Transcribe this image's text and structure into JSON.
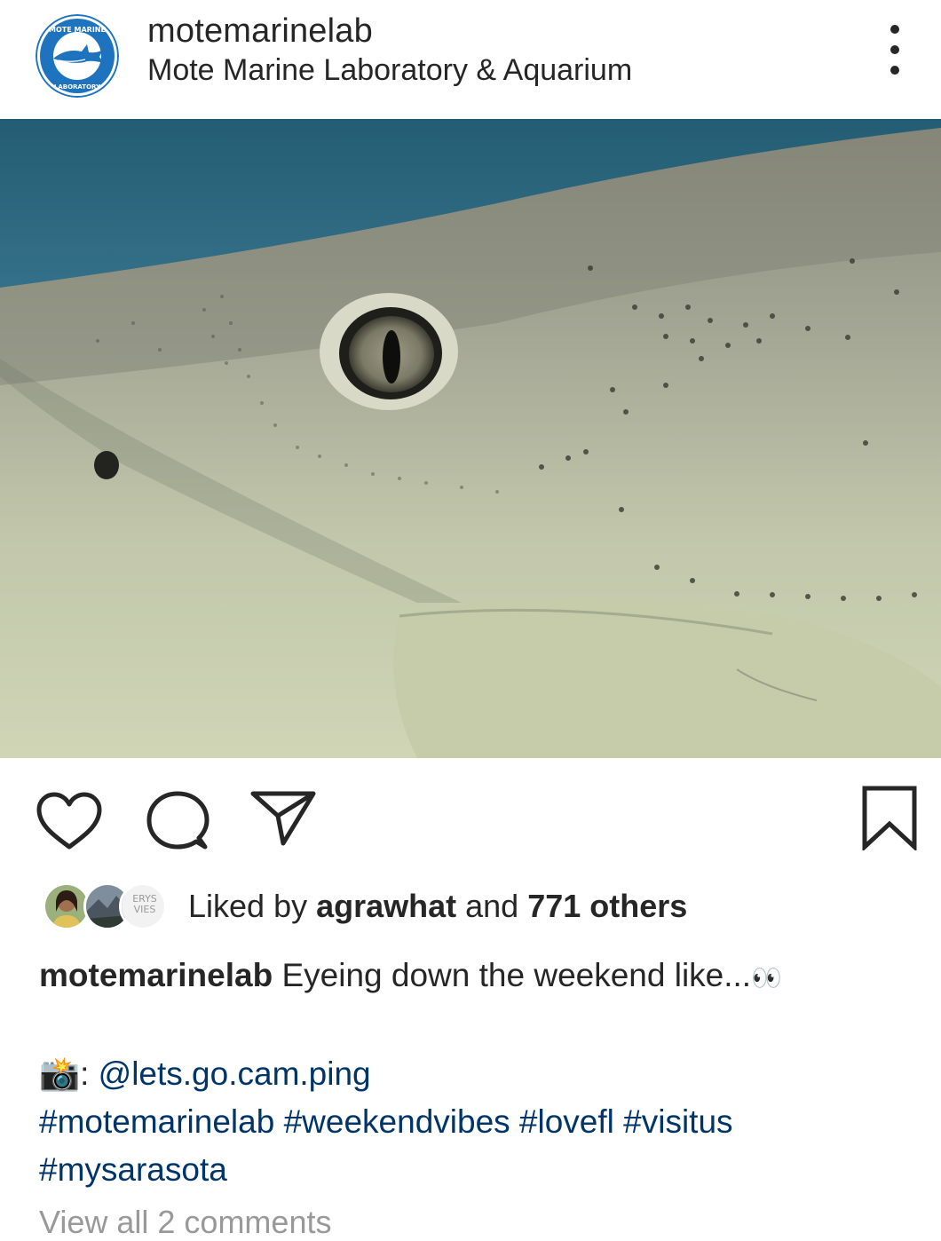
{
  "post": {
    "username": "motemarinelab",
    "location": "Mote Marine Laboratory & Aquarium",
    "avatar_text_top": "MOTE MARINE",
    "avatar_text_bottom": "LABORATORY",
    "avatar_icon": "shark-logo-icon",
    "more_icon": "more-vertical-icon"
  },
  "actions": {
    "like_icon": "heart-icon",
    "comment_icon": "comment-icon",
    "share_icon": "paper-plane-icon",
    "save_icon": "bookmark-icon"
  },
  "likes": {
    "prefix": "Liked by ",
    "first_liker": "agrawhat",
    "middle": " and ",
    "others": "771 others",
    "liker_badge_text_1": "ERYS",
    "liker_badge_text_2": "VIES"
  },
  "caption": {
    "username": "motemarinelab",
    "text": " Eyeing down the weekend like...",
    "emoji": "👀",
    "camera_emoji": "📸",
    "credit_prefix": ": ",
    "credit_handle": "@lets.go.cam.ping",
    "hashtags_line1": "#motemarinelab #weekendvibes #lovefl #visitus",
    "hashtags_line2": "#mysarasota"
  },
  "comments": {
    "label": "View all 2 comments"
  },
  "colors": {
    "text": "#262626",
    "link": "#003569",
    "logo_blue": "#1e73be",
    "water": "#2f6f8a"
  }
}
